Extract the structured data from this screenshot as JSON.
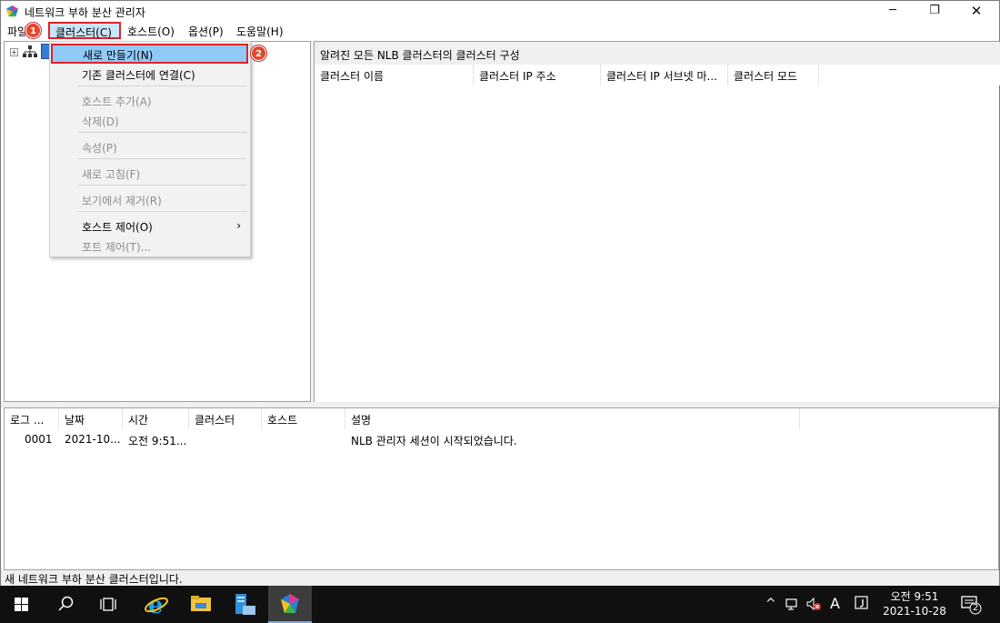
{
  "window": {
    "title": "네트워크 부하 분산 관리자",
    "minimize_glyph": "─",
    "maximize_glyph": "❐",
    "close_glyph": "✕"
  },
  "menubar": {
    "file": "파일(F)",
    "cluster": "클러스터(C)",
    "host": "호스트(O)",
    "options": "옵션(P)",
    "help": "도움말(H)"
  },
  "badges": {
    "one": "1",
    "two": "2"
  },
  "dropdown": {
    "items": [
      {
        "label": "새로 만들기(N)",
        "state": "highlighted"
      },
      {
        "label": "기존 클러스터에 연결(C)",
        "state": "enabled"
      },
      {
        "label": "호스트 추가(A)",
        "state": "disabled"
      },
      {
        "label": "삭제(D)",
        "state": "disabled"
      },
      {
        "label": "속성(P)",
        "state": "disabled"
      },
      {
        "label": "새로 고침(F)",
        "state": "disabled"
      },
      {
        "label": "보기에서 제거(R)",
        "state": "disabled"
      },
      {
        "label": "호스트 제어(O)",
        "state": "enabled",
        "submenu": true
      },
      {
        "label": "포트 제어(T)...",
        "state": "disabled"
      }
    ],
    "submenu_arrow": "›"
  },
  "tree": {
    "expander": "+"
  },
  "cluster_pane": {
    "title": "알려진 모든 NLB 클러스터의 클러스터 구성",
    "columns": [
      "클러스터 이름",
      "클러스터 IP 주소",
      "클러스터 IP 서브넷 마...",
      "클러스터 모드"
    ]
  },
  "log_pane": {
    "columns": [
      "로그 ...",
      "날짜",
      "시간",
      "클러스터",
      "호스트",
      "설명"
    ],
    "rows": [
      {
        "log": "0001",
        "date": "2021-10...",
        "time": "오전 9:51...",
        "cluster": "",
        "host": "",
        "description": "NLB 관리자 세션이 시작되었습니다."
      }
    ]
  },
  "statusbar": {
    "text": "새 네트워크 부하 분산 클러스터입니다."
  },
  "taskbar": {
    "icons": [
      "windows-start-icon",
      "search-icon",
      "task-view-icon",
      "internet-explorer-icon",
      "file-explorer-icon",
      "server-manager-icon",
      "nlb-manager-icon"
    ],
    "tray": {
      "chevron": "^",
      "ime": "A",
      "time": "오전 9:51",
      "date": "2021-10-28",
      "notification_count": "2"
    }
  },
  "colors": {
    "highlight_border": "#e0222a",
    "highlight_fill": "#91c9f7",
    "badge": "#e0492a",
    "taskbar": "#101010"
  }
}
